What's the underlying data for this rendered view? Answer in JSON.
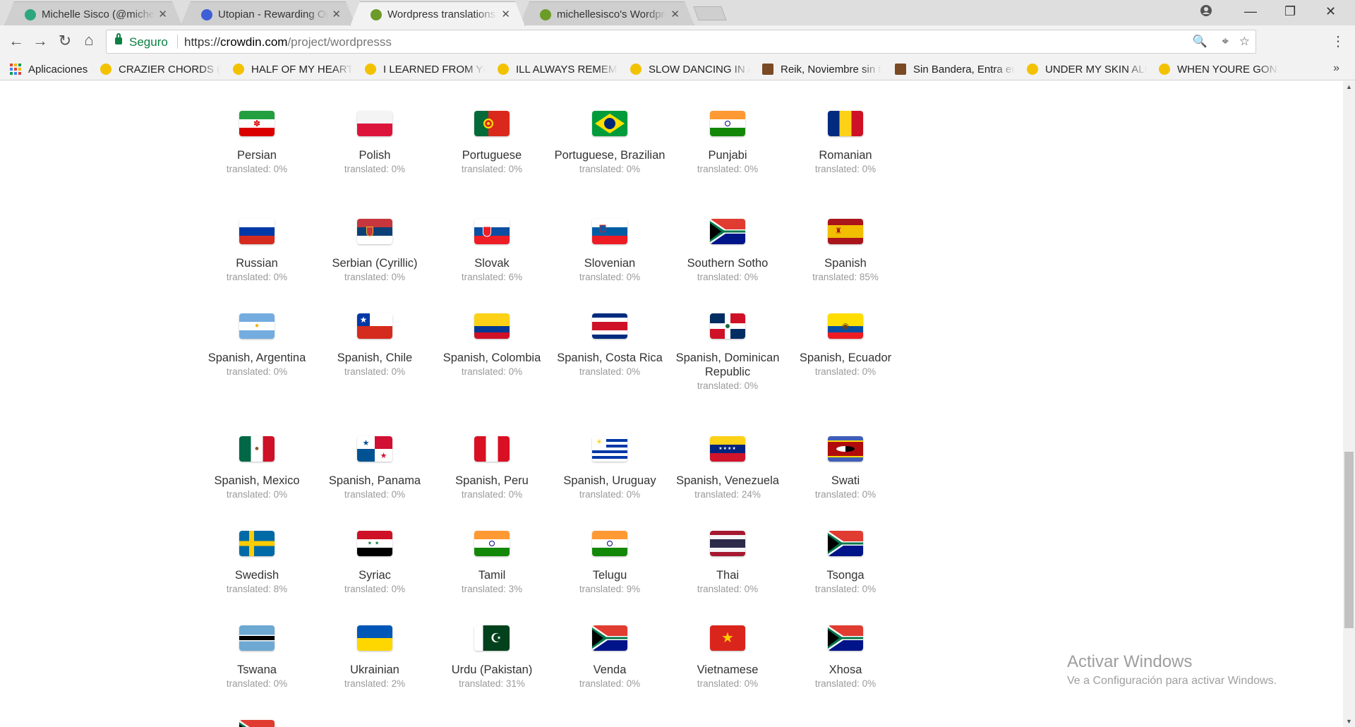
{
  "tabs": [
    {
      "title": "Michelle Sisco (@michell",
      "favicon_color": "#2ea77d",
      "active": false
    },
    {
      "title": "Utopian - Rewarding Op",
      "favicon_color": "#3f5fd6",
      "active": false
    },
    {
      "title": "Wordpress translations: c",
      "favicon_color": "#6c9b27",
      "active": true
    },
    {
      "title": "michellesisco's Wordpres",
      "favicon_color": "#6c9b27",
      "active": false
    }
  ],
  "toolbar": {
    "secure_label": "Seguro",
    "url_scheme": "https://",
    "url_domain": "crowdin.com",
    "url_path": "/project/wordpresss"
  },
  "bookmarks": [
    {
      "label": "Aplicaciones",
      "icon": "apps-grid-icon"
    },
    {
      "label": "CRAZIER CHORDS (ve",
      "icon": "chord-site-icon"
    },
    {
      "label": "HALF OF MY HEART C",
      "icon": "chord-site-icon"
    },
    {
      "label": "I LEARNED FROM YO",
      "icon": "chord-site-icon"
    },
    {
      "label": "ILL ALWAYS REMEMB",
      "icon": "chord-site-icon"
    },
    {
      "label": "SLOW DANCING IN A",
      "icon": "chord-site-icon"
    },
    {
      "label": "Reik, Noviembre sin t",
      "icon": "tab-site-icon"
    },
    {
      "label": "Sin Bandera, Entra en",
      "icon": "tab-site-icon"
    },
    {
      "label": "UNDER MY SKIN ALB",
      "icon": "chord-site-icon"
    },
    {
      "label": "WHEN YOURE GONE",
      "icon": "chord-site-icon"
    }
  ],
  "languages": [
    {
      "name": "Persian",
      "status": "translated: 0%"
    },
    {
      "name": "Polish",
      "status": "translated: 0%"
    },
    {
      "name": "Portuguese",
      "status": "translated: 0%"
    },
    {
      "name": "Portuguese, Brazilian",
      "status": "translated: 0%"
    },
    {
      "name": "Punjabi",
      "status": "translated: 0%"
    },
    {
      "name": "Romanian",
      "status": "translated: 0%"
    },
    {
      "name": "Russian",
      "status": "translated: 0%"
    },
    {
      "name": "Serbian (Cyrillic)",
      "status": "translated: 0%"
    },
    {
      "name": "Slovak",
      "status": "translated: 6%"
    },
    {
      "name": "Slovenian",
      "status": "translated: 0%"
    },
    {
      "name": "Southern Sotho",
      "status": "translated: 0%"
    },
    {
      "name": "Spanish",
      "status": "translated: 85%"
    },
    {
      "name": "Spanish, Argentina",
      "status": "translated: 0%"
    },
    {
      "name": "Spanish, Chile",
      "status": "translated: 0%"
    },
    {
      "name": "Spanish, Colombia",
      "status": "translated: 0%"
    },
    {
      "name": "Spanish, Costa Rica",
      "status": "translated: 0%"
    },
    {
      "name": "Spanish, Dominican Republic",
      "status": "translated: 0%"
    },
    {
      "name": "Spanish, Ecuador",
      "status": "translated: 0%"
    },
    {
      "name": "Spanish, Mexico",
      "status": "translated: 0%"
    },
    {
      "name": "Spanish, Panama",
      "status": "translated: 0%"
    },
    {
      "name": "Spanish, Peru",
      "status": "translated: 0%"
    },
    {
      "name": "Spanish, Uruguay",
      "status": "translated: 0%"
    },
    {
      "name": "Spanish, Venezuela",
      "status": "translated: 24%"
    },
    {
      "name": "Swati",
      "status": "translated: 0%"
    },
    {
      "name": "Swedish",
      "status": "translated: 8%"
    },
    {
      "name": "Syriac",
      "status": "translated: 0%"
    },
    {
      "name": "Tamil",
      "status": "translated: 3%"
    },
    {
      "name": "Telugu",
      "status": "translated: 9%"
    },
    {
      "name": "Thai",
      "status": "translated: 0%"
    },
    {
      "name": "Tsonga",
      "status": "translated: 0%"
    },
    {
      "name": "Tswana",
      "status": "translated: 0%"
    },
    {
      "name": "Ukrainian",
      "status": "translated: 2%"
    },
    {
      "name": "Urdu (Pakistan)",
      "status": "translated: 31%"
    },
    {
      "name": "Venda",
      "status": "translated: 0%"
    },
    {
      "name": "Vietnamese",
      "status": "translated: 0%"
    },
    {
      "name": "Xhosa",
      "status": "translated: 0%"
    }
  ],
  "watermark": {
    "title": "Activar Windows",
    "subtitle": "Ve a Configuración para activar Windows."
  }
}
